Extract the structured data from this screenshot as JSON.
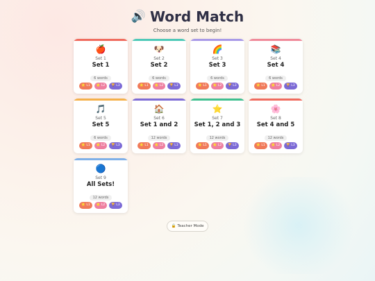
{
  "app": {
    "title": "Word Match",
    "title_icon": "🔊",
    "subtitle": "Choose a word set to begin!"
  },
  "levels": [
    "⭐ L1",
    "🌟 L2",
    "🏆 L3"
  ],
  "level_colors": [
    "#f07a5a",
    "#ee7fa0",
    "#7c6ad6"
  ],
  "sets": [
    {
      "emoji": "🍎",
      "set_label": "Set 1",
      "name": "Set 1",
      "count": "6 words",
      "color": "#f06b5e"
    },
    {
      "emoji": "🐶",
      "set_label": "Set 2",
      "name": "Set 2",
      "count": "6 words",
      "color": "#4ec9b8"
    },
    {
      "emoji": "🌈",
      "set_label": "Set 3",
      "name": "Set 3",
      "count": "6 words",
      "color": "#a99ae8"
    },
    {
      "emoji": "📚",
      "set_label": "Set 4",
      "name": "Set 4",
      "count": "6 words",
      "color": "#f08a9a"
    },
    {
      "emoji": "🎵",
      "set_label": "Set 5",
      "name": "Set 5",
      "count": "6 words",
      "color": "#f5b04a"
    },
    {
      "emoji": "🏠",
      "set_label": "Set 6",
      "name": "Set 1 and 2",
      "count": "12 words",
      "color": "#7c6ad6"
    },
    {
      "emoji": "⭐",
      "set_label": "Set 7",
      "name": "Set 1, 2 and 3",
      "count": "12 words",
      "color": "#3fbf8f"
    },
    {
      "emoji": "🌸",
      "set_label": "Set 8",
      "name": "Set 4 and 5",
      "count": "12 words",
      "color": "#f06b5e"
    },
    {
      "emoji": "🔵",
      "set_label": "Set 9",
      "name": "All Sets!",
      "count": "12 words",
      "color": "#7fb0e8"
    }
  ],
  "teacher_button": {
    "icon": "🔒",
    "label": "Teacher Mode"
  }
}
